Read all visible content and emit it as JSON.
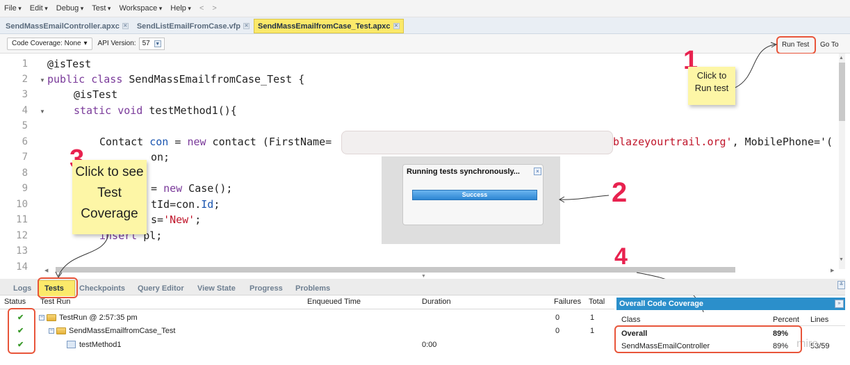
{
  "menu": {
    "items": [
      "File",
      "Edit",
      "Debug",
      "Test",
      "Workspace",
      "Help"
    ],
    "nav_back": "<",
    "nav_forward": ">"
  },
  "file_tabs": [
    {
      "label": "SendMassEmailController.apxc"
    },
    {
      "label": "SendListEmailFromCase.vfp"
    },
    {
      "label": "SendMassEmailfromCase_Test.apxc",
      "active": true
    }
  ],
  "toolbar": {
    "coverage_label": "Code Coverage: None",
    "api_label": "API Version:",
    "api_value": "57",
    "run_test": "Run Test",
    "go_to": "Go To"
  },
  "editor": {
    "line_numbers": [
      "1",
      "2",
      "3",
      "4",
      "5",
      "6",
      "7",
      "8",
      "9",
      "10",
      "11",
      "12",
      "13",
      "14"
    ],
    "fragments": {
      "l1": "@isTest",
      "l2_kw": "public class",
      "l2_rest": " SendMassEmailfromCase_Test {",
      "l3": "@isTest",
      "l4_kw": "static void",
      "l4_rest": " testMethod1(){",
      "l6_a": "Contact ",
      "l6_b": "con",
      "l6_c": " = ",
      "l6_d": "new",
      "l6_e": " contact (FirstName=",
      "l6_f": "blazeyourtrail.org'",
      "l6_g": ", MobilePhone='(",
      "l7_a": "on;",
      "l9_a": "= ",
      "l9_b": "new",
      "l9_c": " Case();",
      "l10_a": "tId=con.",
      "l10_b": "Id",
      "l10_c": ";",
      "l11_a": "s=",
      "l11_b": "'New'",
      "l11_c": ";",
      "l12_a": "insert",
      "l12_b": " pl;"
    }
  },
  "modal": {
    "title": "Running tests synchronously...",
    "close": "×",
    "progress_text": "Success"
  },
  "annotations": {
    "num1": "1",
    "note1": "Click to Run test",
    "num2": "2",
    "num3": "3",
    "note3": "Click to see Test Coverage",
    "num4": "4"
  },
  "panel_tabs": [
    "Logs",
    "Tests",
    "Checkpoints",
    "Query Editor",
    "View State",
    "Progress",
    "Problems"
  ],
  "tests_table": {
    "headers": {
      "status": "Status",
      "test_run": "Test Run",
      "enqueued": "Enqueued Time",
      "duration": "Duration",
      "failures": "Failures",
      "total": "Total"
    },
    "rows": [
      {
        "status": "✔",
        "name": "TestRun @ 2:57:35 pm",
        "enqueued": "",
        "duration": "",
        "failures": "0",
        "total": "1"
      },
      {
        "status": "✔",
        "name": "SendMassEmailfromCase_Test",
        "enqueued": "",
        "duration": "",
        "failures": "0",
        "total": "1"
      },
      {
        "status": "✔",
        "name": "testMethod1",
        "enqueued": "",
        "duration": "0:00",
        "failures": "",
        "total": ""
      }
    ]
  },
  "coverage": {
    "title": "Overall Code Coverage",
    "button": "»",
    "headers": {
      "class": "Class",
      "percent": "Percent",
      "lines": "Lines"
    },
    "rows": [
      {
        "class": "Overall",
        "percent": "89%",
        "lines": ""
      },
      {
        "class": "SendMassEmailController",
        "percent": "89%",
        "lines": "53/59"
      }
    ]
  },
  "watermark": "miro",
  "colors": {
    "accent_red": "#e8224f",
    "highlight_orange": "#e8553a",
    "note_yellow": "#fdf6a6",
    "tab_yellow": "#fbe96a",
    "coverage_blue": "#2b8fcb"
  }
}
